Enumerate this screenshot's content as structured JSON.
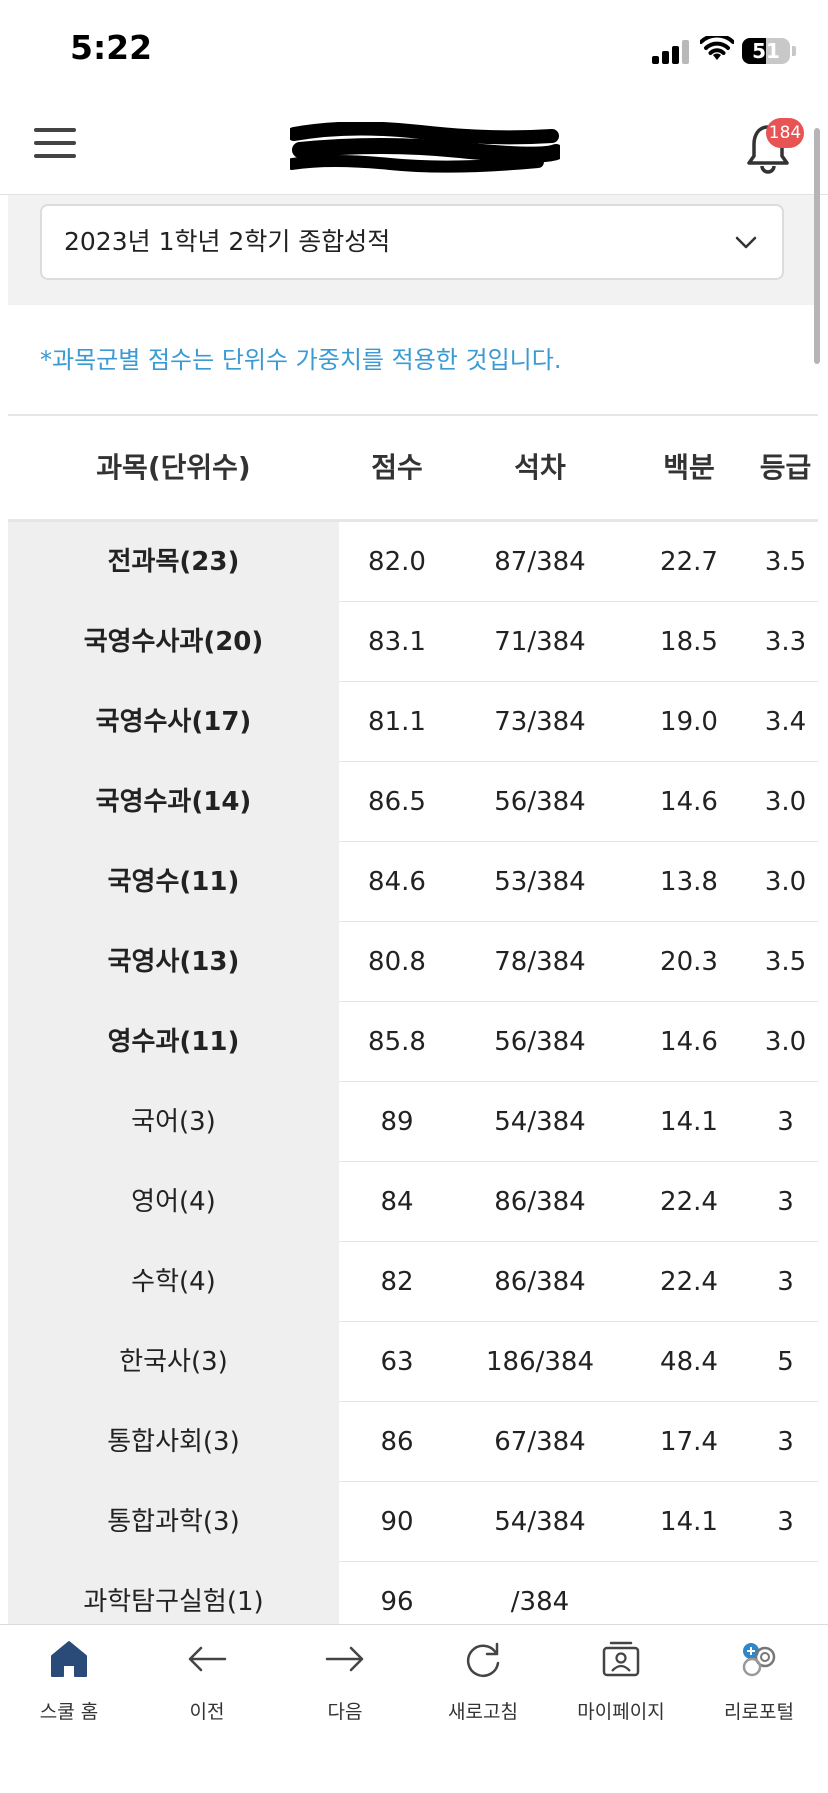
{
  "status_bar": {
    "time": "5:22",
    "battery": "51",
    "battery_level": 0.51
  },
  "header": {
    "notification_count": "184"
  },
  "term_select": {
    "value": "2023년 1학년 2학기 종합성적"
  },
  "note": "*과목군별 점수는 단위수 가중치를 적용한 것입니다.",
  "table": {
    "headers": {
      "subject": "과목(단위수)",
      "score": "점수",
      "rank": "석차",
      "percentile": "백분",
      "grade": "등급"
    },
    "rows": [
      {
        "subject": "전과목(23)",
        "score": "82.0",
        "rank": "87/384",
        "percentile": "22.7",
        "grade": "3.5"
      },
      {
        "subject": "국영수사과(20)",
        "score": "83.1",
        "rank": "71/384",
        "percentile": "18.5",
        "grade": "3.3"
      },
      {
        "subject": "국영수사(17)",
        "score": "81.1",
        "rank": "73/384",
        "percentile": "19.0",
        "grade": "3.4"
      },
      {
        "subject": "국영수과(14)",
        "score": "86.5",
        "rank": "56/384",
        "percentile": "14.6",
        "grade": "3.0"
      },
      {
        "subject": "국영수(11)",
        "score": "84.6",
        "rank": "53/384",
        "percentile": "13.8",
        "grade": "3.0"
      },
      {
        "subject": "국영사(13)",
        "score": "80.8",
        "rank": "78/384",
        "percentile": "20.3",
        "grade": "3.5"
      },
      {
        "subject": "영수과(11)",
        "score": "85.8",
        "rank": "56/384",
        "percentile": "14.6",
        "grade": "3.0"
      },
      {
        "subject": "국어(3)",
        "score": "89",
        "rank": "54/384",
        "percentile": "14.1",
        "grade": "3"
      },
      {
        "subject": "영어(4)",
        "score": "84",
        "rank": "86/384",
        "percentile": "22.4",
        "grade": "3"
      },
      {
        "subject": "수학(4)",
        "score": "82",
        "rank": "86/384",
        "percentile": "22.4",
        "grade": "3"
      },
      {
        "subject": "한국사(3)",
        "score": "63",
        "rank": "186/384",
        "percentile": "48.4",
        "grade": "5"
      },
      {
        "subject": "통합사회(3)",
        "score": "86",
        "rank": "67/384",
        "percentile": "17.4",
        "grade": "3"
      },
      {
        "subject": "통합과학(3)",
        "score": "90",
        "rank": "54/384",
        "percentile": "14.1",
        "grade": "3"
      },
      {
        "subject": "과학탐구실험(1)",
        "score": "96",
        "rank": "/384",
        "percentile": "",
        "grade": ""
      }
    ]
  },
  "bottom_nav": [
    {
      "label": "스쿨 홈",
      "icon": "home-icon"
    },
    {
      "label": "이전",
      "icon": "arrow-left-icon"
    },
    {
      "label": "다음",
      "icon": "arrow-right-icon"
    },
    {
      "label": "새로고침",
      "icon": "refresh-icon"
    },
    {
      "label": "마이페이지",
      "icon": "profile-card-icon"
    },
    {
      "label": "리로포털",
      "icon": "portal-icon"
    }
  ],
  "colors": {
    "accent": "#3a9ad4",
    "badge": "#e85454",
    "subject_bg": "#efefef",
    "home_icon": "#2a4a78"
  }
}
